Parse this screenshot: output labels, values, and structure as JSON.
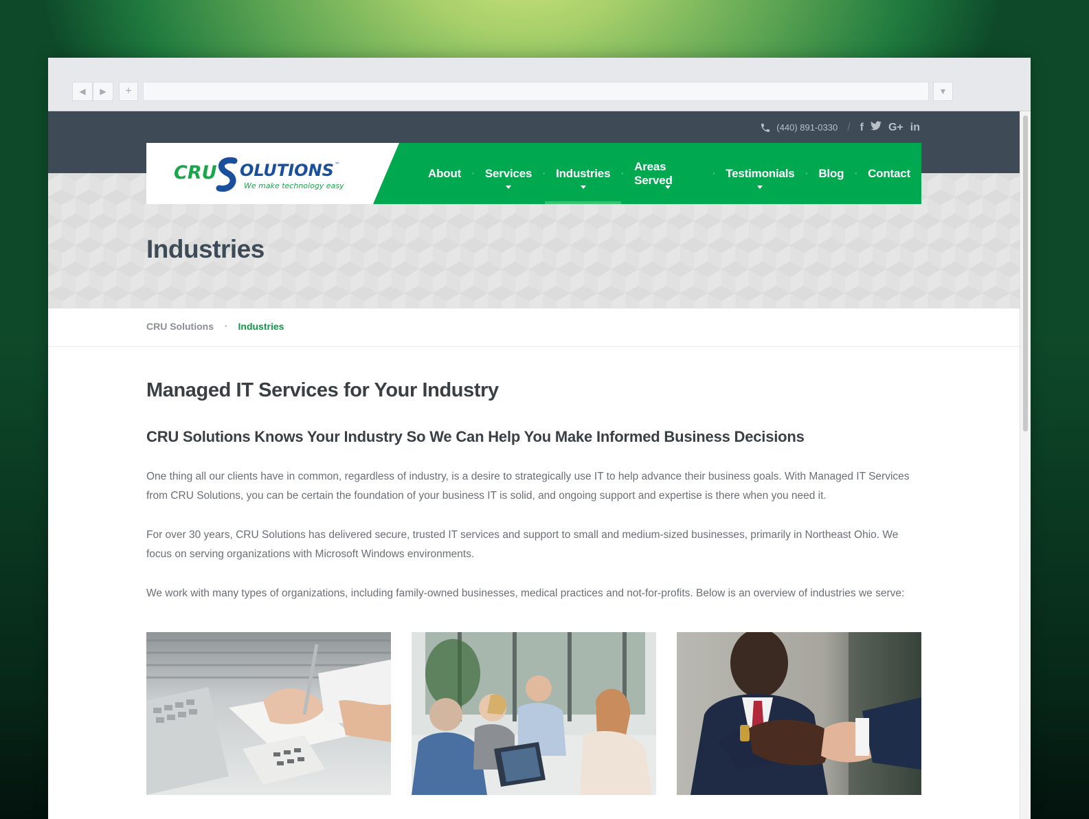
{
  "browser": {
    "back_glyph": "◀",
    "forward_glyph": "▶",
    "new_tab_glyph": "+",
    "menu_glyph": "▼",
    "address": ""
  },
  "topbar": {
    "phone": "(440) 891-0330",
    "separator": "/",
    "social_icons": [
      "facebook-icon",
      "twitter-icon",
      "google-plus-icon",
      "linkedin-icon"
    ],
    "social_glyphs": {
      "facebook": "f",
      "twitter": "t",
      "google": "G+",
      "linkedin": "in"
    }
  },
  "logo": {
    "word_left": "CRU",
    "word_right": "OLUTIONS",
    "tm": "™",
    "tagline": "We make technology easy"
  },
  "nav": {
    "items": [
      {
        "label": "About"
      },
      {
        "label": "Services"
      },
      {
        "label": "Industries"
      },
      {
        "label": "Areas Served"
      },
      {
        "label": "Testimonials"
      },
      {
        "label": "Blog"
      },
      {
        "label": "Contact"
      }
    ],
    "separator": "•"
  },
  "page": {
    "title": "Industries"
  },
  "breadcrumb": {
    "home": "CRU Solutions",
    "separator": "•",
    "current": "Industries"
  },
  "content": {
    "heading": "Managed IT Services for Your Industry",
    "subheading": "CRU Solutions Knows Your Industry So We Can Help You Make Informed Business Decisions",
    "paragraphs": [
      "One thing all our clients have in common, regardless of industry, is a desire to strategically use IT to help advance their business goals. With Managed IT Services from CRU Solutions, you can be certain the foundation of your business IT is solid, and ongoing support and expertise is there when you need it.",
      "For over 30 years, CRU Solutions has delivered secure, trusted IT services and support to small and medium-sized businesses, primarily in Northeast Ohio. We focus on serving organizations with Microsoft Windows environments.",
      "We work with many types of organizations, including family-owned businesses, medical practices and not-for-profits. Below is an overview of industries we serve:"
    ]
  },
  "colors": {
    "brand_green": "#00a84f",
    "header_slate": "#3e4b57",
    "logo_blue": "#1a4f9c",
    "logo_green": "#1aa64a"
  }
}
